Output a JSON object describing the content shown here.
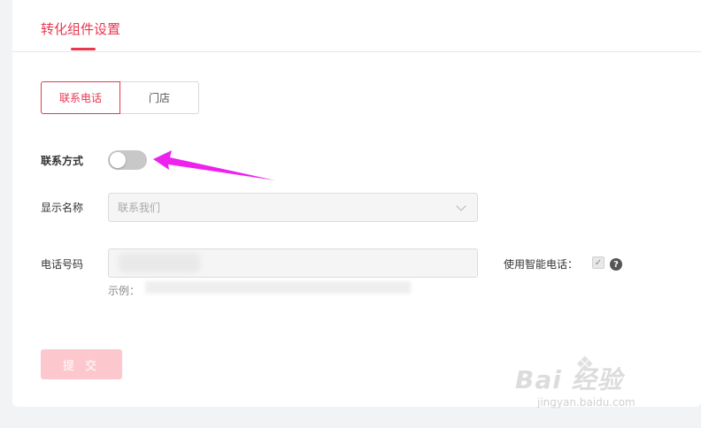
{
  "header": {
    "title": "转化组件设置"
  },
  "tabs": [
    {
      "label": "联系电话",
      "active": true
    },
    {
      "label": "门店",
      "active": false
    }
  ],
  "form": {
    "contact_label": "联系方式",
    "contact_toggle_on": false,
    "display_name_label": "显示名称",
    "display_name_value": "联系我们",
    "phone_label": "电话号码",
    "phone_value": "",
    "example_prefix": "示例：",
    "smart_phone_label": "使用智能电话：",
    "smart_phone_checked": true,
    "help_glyph": "?",
    "submit_label": "提 交"
  },
  "watermark": {
    "logo": "Bai 经验",
    "subtext": "jingyan.baidu.com"
  },
  "colors": {
    "accent": "#e8374f",
    "annotation_arrow": "#ee22ee",
    "submit_disabled": "#fcc8cd"
  }
}
